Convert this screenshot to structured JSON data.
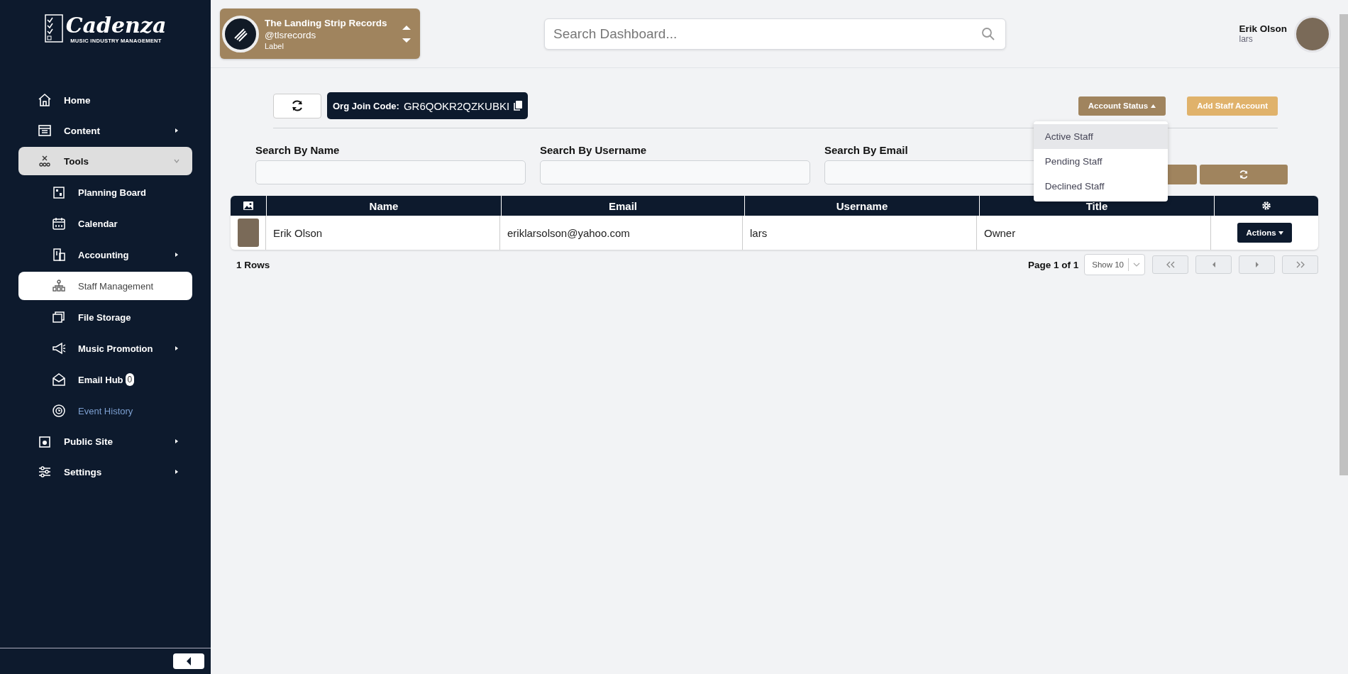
{
  "sidebar": {
    "logo": {
      "title": "Cadenza",
      "subtitle": "MUSIC INDUSTRY MANAGEMENT"
    },
    "items": [
      {
        "label": "Home",
        "selected": false,
        "expanded": false,
        "has_children": false
      },
      {
        "label": "Content",
        "selected": false,
        "expanded": false,
        "has_children": true
      },
      {
        "label": "Tools",
        "selected": false,
        "expanded": true,
        "has_children": true,
        "children": [
          {
            "label": "Planning Board",
            "selected": false,
            "has_children": false,
            "accent": false
          },
          {
            "label": "Calendar",
            "selected": false,
            "has_children": false,
            "accent": false
          },
          {
            "label": "Accounting",
            "selected": false,
            "has_children": true,
            "accent": false
          },
          {
            "label": "Staff Management",
            "selected": true,
            "has_children": false,
            "accent": false
          },
          {
            "label": "File Storage",
            "selected": false,
            "has_children": false,
            "accent": false
          },
          {
            "label": "Music Promotion",
            "selected": false,
            "has_children": true,
            "accent": false
          },
          {
            "label": "Email Hub",
            "selected": false,
            "has_children": false,
            "accent": false,
            "badge": "0"
          },
          {
            "label": "Event History",
            "selected": false,
            "has_children": false,
            "accent": true
          }
        ]
      },
      {
        "label": "Public Site",
        "selected": false,
        "expanded": false,
        "has_children": true
      },
      {
        "label": "Settings",
        "selected": false,
        "expanded": false,
        "has_children": true
      }
    ]
  },
  "org": {
    "name": "The Landing Strip Records",
    "handle": "@tlsrecords",
    "type": "Label"
  },
  "search": {
    "placeholder": "Search Dashboard..."
  },
  "user": {
    "name": "Erik Olson",
    "username": "lars"
  },
  "toolbar": {
    "join_code_label": "Org Join Code:",
    "join_code": "GR6QOKR2QZKUBKI",
    "account_status": "Account Status",
    "add_staff": "Add Staff Account"
  },
  "dropdown": [
    {
      "label": "Active Staff",
      "selected": true
    },
    {
      "label": "Pending Staff",
      "selected": false
    },
    {
      "label": "Declined Staff",
      "selected": false
    }
  ],
  "filters": [
    {
      "label": "Search By Name"
    },
    {
      "label": "Search By Username"
    },
    {
      "label": "Search By Email"
    }
  ],
  "table": {
    "columns": [
      "Name",
      "Email",
      "Username",
      "Title"
    ],
    "rows": [
      {
        "cells": [
          "Erik Olson",
          "eriklarsolson@yahoo.com",
          "lars",
          "Owner"
        ],
        "action": "Actions"
      }
    ]
  },
  "footer": {
    "count": "1 Rows",
    "page": "Page 1 of 1",
    "show": "Show 10"
  }
}
